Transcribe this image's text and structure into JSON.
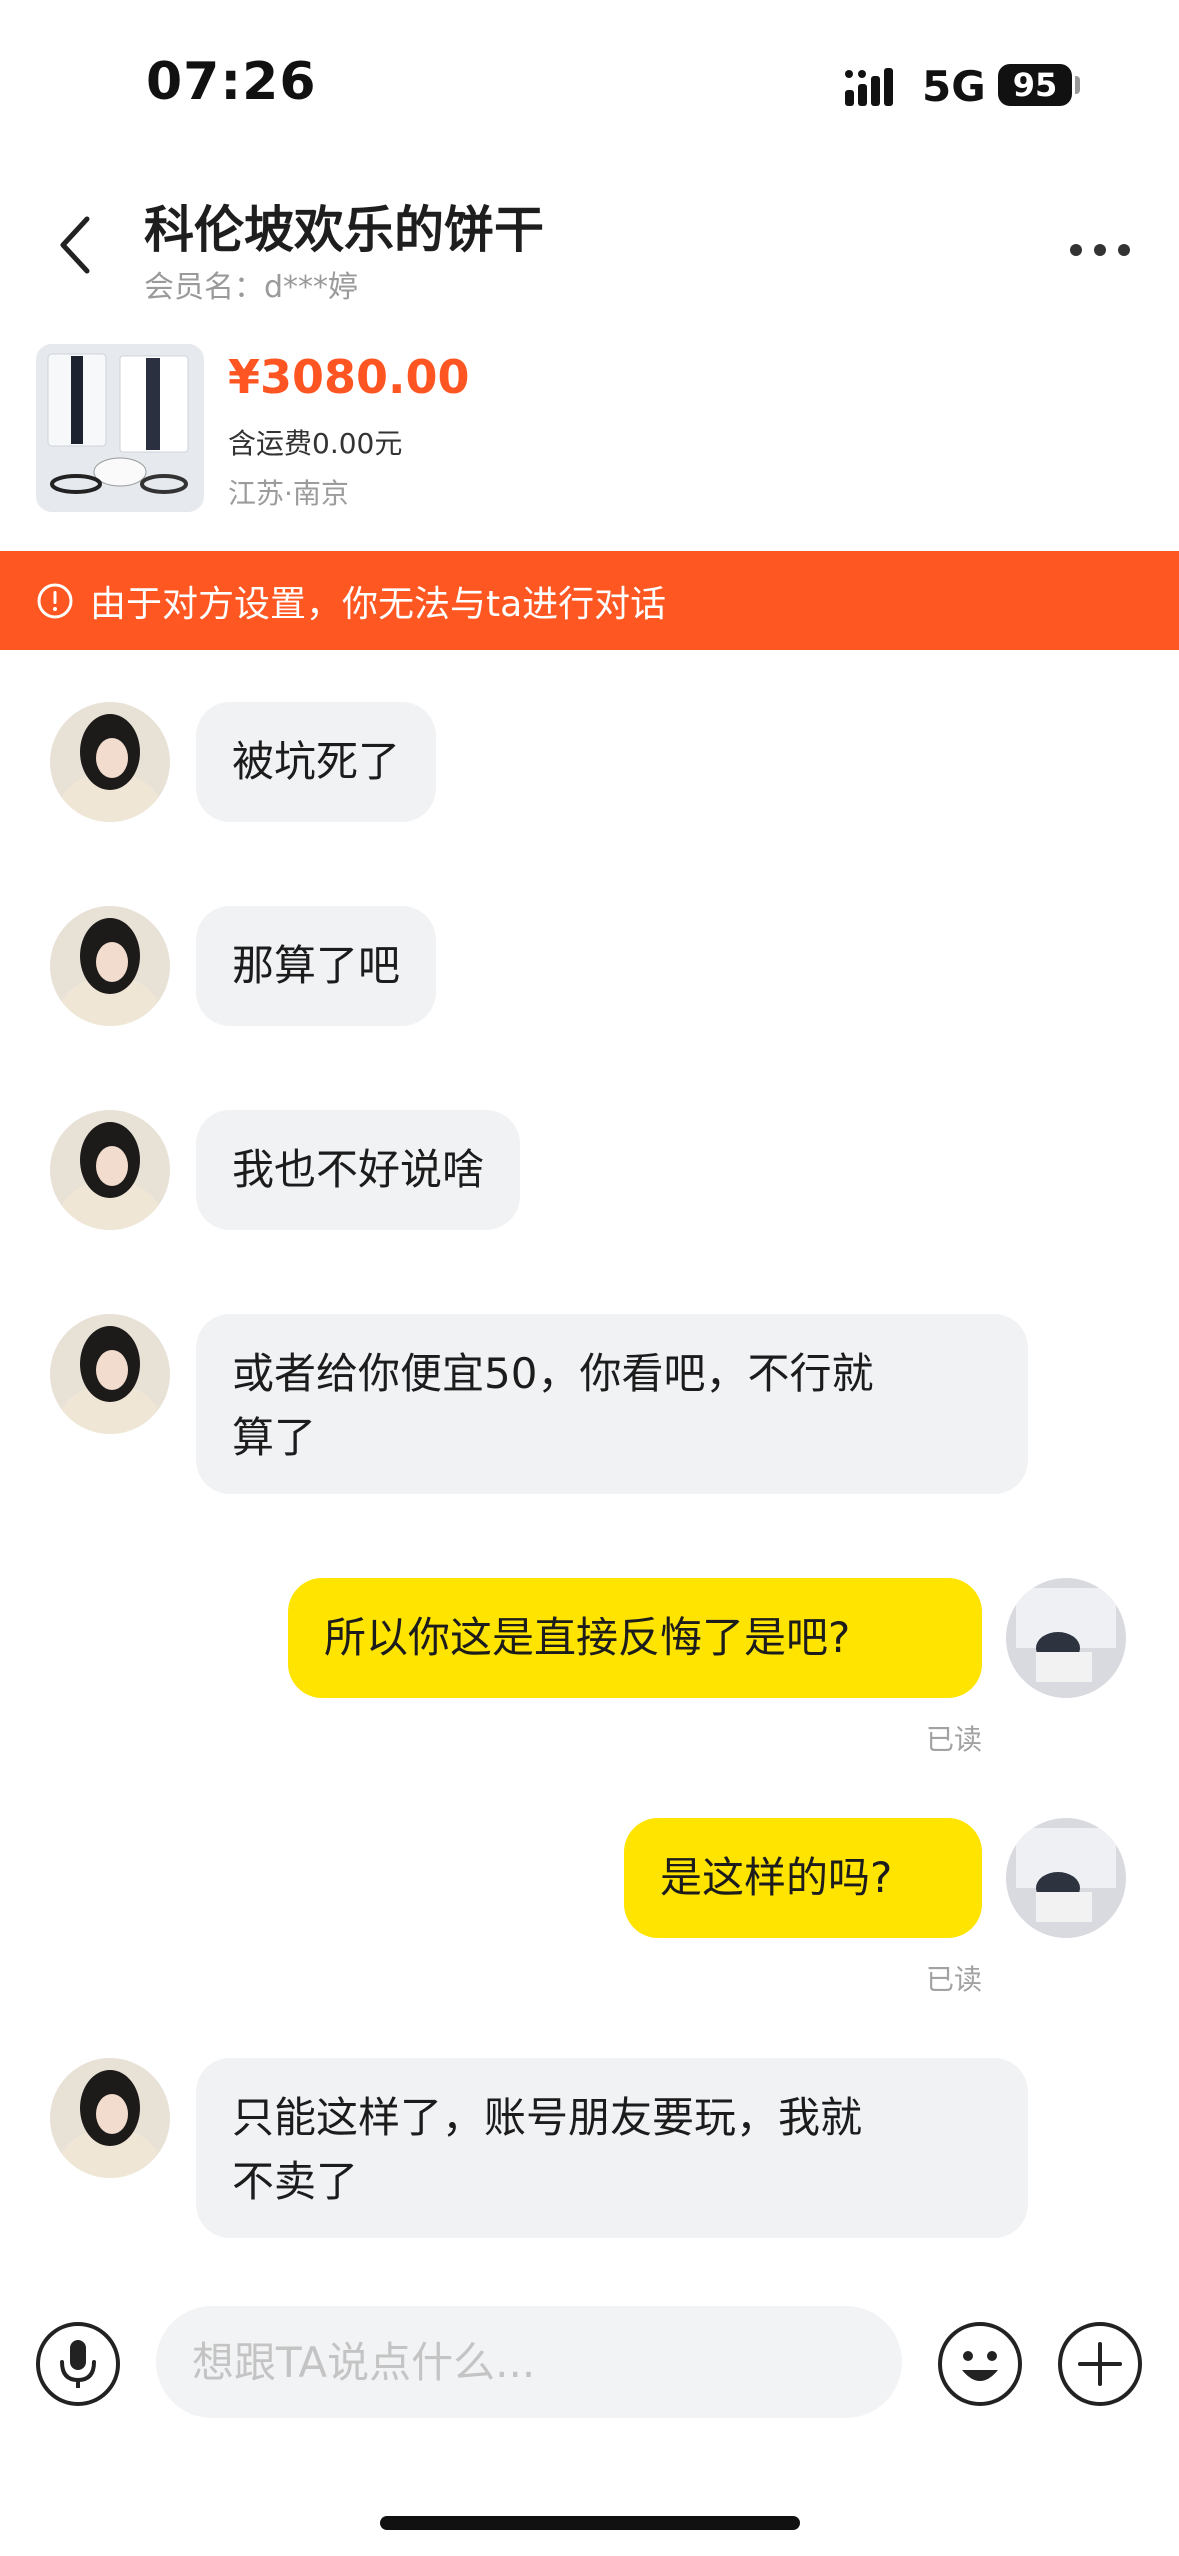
{
  "status_bar": {
    "time": "07:26",
    "network": "5G",
    "battery": "95"
  },
  "header": {
    "title": "科伦坡欢乐的饼干",
    "subtitle": "会员名：d***婷"
  },
  "product": {
    "price": "¥3080.00",
    "shipping": "含运费0.00元",
    "location": "江苏·南京"
  },
  "banner": {
    "text": "由于对方设置，你无法与ta进行对话"
  },
  "messages": [
    {
      "side": "in",
      "text": "被坑死了"
    },
    {
      "side": "in",
      "text": "那算了吧"
    },
    {
      "side": "in",
      "text": "我也不好说啥"
    },
    {
      "side": "in",
      "line1": "或者给你便宜50，你看吧，不行就",
      "line2": "算了"
    },
    {
      "side": "out",
      "text": "所以你这是直接反悔了是吧?",
      "status": "已读"
    },
    {
      "side": "out",
      "text": "是这样的吗?",
      "status": "已读"
    },
    {
      "side": "in",
      "line1": "只能这样了，账号朋友要玩，我就",
      "line2": "不卖了"
    }
  ],
  "input": {
    "placeholder": "想跟TA说点什么..."
  },
  "colors": {
    "accent": "#ff5722",
    "price": "#ff5522",
    "out_bubble": "#ffe400",
    "in_bubble": "#f1f2f4"
  }
}
